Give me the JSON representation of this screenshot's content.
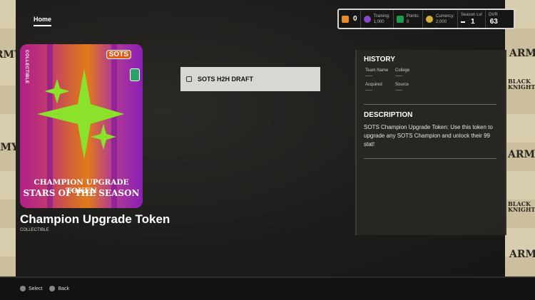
{
  "header": {
    "home_tab": "Home"
  },
  "stats": {
    "trophies": "0",
    "training_label": "Training:",
    "training_value": "1,000",
    "points_label": "Points:",
    "points_value": "0",
    "currency_label": "Currency:",
    "currency_value": "2,000",
    "season_label": "Season Lvl",
    "season_value": "1",
    "ovr_label": "OVR",
    "ovr_value": "63",
    "trophy_color": "#e88a2a",
    "training_color": "#8a45c8",
    "points_color": "#1f9b4b",
    "currency_color": "#d7b23a"
  },
  "card": {
    "vertical_label": "COLLECTIBLE",
    "logo_text": "SOTS",
    "line1": "CHAMPION UPGRADE TOKEN",
    "line2": "STARS OF THE SEASON",
    "star_color": "#8ae22a"
  },
  "item": {
    "name": "Champion Upgrade Token",
    "type": "COLLECTIBLE"
  },
  "source_box": {
    "label": "SOTS H2H DRAFT"
  },
  "history": {
    "title": "HISTORY",
    "team_name_label": "Team Name",
    "team_name_value": "-----",
    "college_label": "College",
    "college_value": "-----",
    "acquired_label": "Acquired",
    "acquired_value": "-----",
    "source_label": "Source",
    "source_value": "-----"
  },
  "description": {
    "title": "DESCRIPTION",
    "text": "SOTS Champion Upgrade Token: Use this token to upgrade any SOTS Champion and unlock their 99 stat!"
  },
  "side_wallpaper": {
    "text1": "ARMY",
    "text2": "BLACK KNIGHTS"
  },
  "footer": {
    "select_label": "Select",
    "back_label": "Back"
  }
}
